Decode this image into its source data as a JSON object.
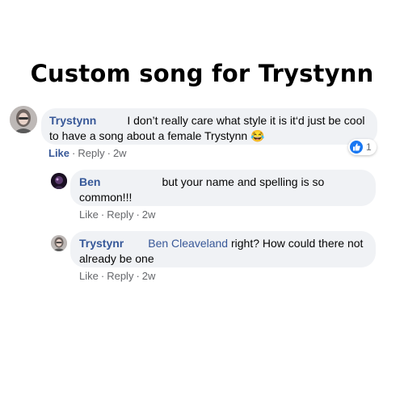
{
  "headline": "Custom song for Trystynn",
  "comments": [
    {
      "author": "Trystynn",
      "text": "I don’t really care what style it is it‘d just be cool to have a song about a female Trystynn",
      "emoji": "😂",
      "actions": {
        "like": "Like",
        "reply": "Reply",
        "time": "2w"
      },
      "reaction_count": "1"
    },
    {
      "author": "Ben",
      "text": "but your name and spelling is so common!!!",
      "actions": {
        "like": "Like",
        "reply": "Reply",
        "time": "2w"
      }
    },
    {
      "author": "Trystynr",
      "mention": "Ben Cleaveland",
      "text": " right? How could there not already be one",
      "actions": {
        "like": "Like",
        "reply": "Reply",
        "time": "2w"
      }
    }
  ],
  "colors": {
    "link": "#385898",
    "bubble": "#f0f2f5",
    "meta": "#65676b",
    "like_badge": "#1877f2"
  },
  "icons": [
    "like-thumb-icon",
    "laughing-emoji-icon"
  ]
}
